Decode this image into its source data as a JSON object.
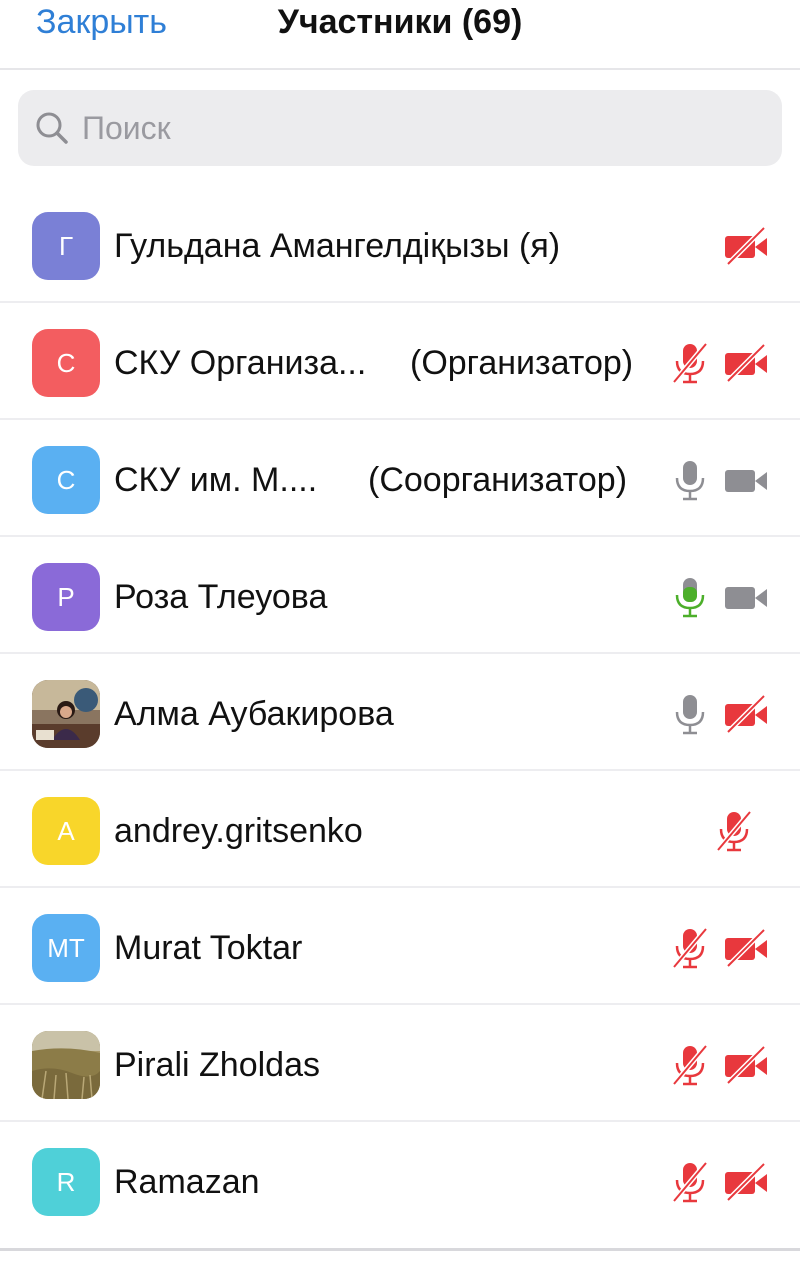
{
  "header": {
    "close_label": "Закрыть",
    "title": "Участники (69)"
  },
  "search": {
    "placeholder": "Поиск",
    "value": ""
  },
  "colors": {
    "accent": "#2f7fd6",
    "muted_red": "#e8383d",
    "active_green": "#4caf2a",
    "neutral_gray": "#8e8e93"
  },
  "participants": [
    {
      "initial": "Г",
      "name": "Гульдана Амангелдіқызы (я)",
      "role": "",
      "avatar_color": "#7a80d6",
      "mic": "none",
      "camera": "off"
    },
    {
      "initial": "С",
      "name": "СКУ Организа...",
      "role": "(Организатор)",
      "avatar_color": "#f35d60",
      "mic": "muted",
      "camera": "off"
    },
    {
      "initial": "С",
      "name": "СКУ им. М....",
      "role": "(Соорганизатор)",
      "avatar_color": "#5ab0f2",
      "mic": "on",
      "camera": "on"
    },
    {
      "initial": "Р",
      "name": "Роза Тлеуова",
      "role": "",
      "avatar_color": "#8a6ad8",
      "mic": "speaking",
      "camera": "on"
    },
    {
      "initial": "",
      "name": "Алма Аубакирова",
      "role": "",
      "avatar_color": "#6a5040",
      "mic": "on",
      "camera": "off"
    },
    {
      "initial": "A",
      "name": "andrey.gritsenko",
      "role": "",
      "avatar_color": "#f8d62a",
      "mic": "muted",
      "camera": "none"
    },
    {
      "initial": "MT",
      "name": "Murat Toktar",
      "role": "",
      "avatar_color": "#5ab0f2",
      "mic": "muted",
      "camera": "off"
    },
    {
      "initial": "",
      "name": "Pirali Zholdas",
      "role": "",
      "avatar_color": "#9a8a5a",
      "mic": "muted",
      "camera": "off"
    },
    {
      "initial": "R",
      "name": "Ramazan",
      "role": "",
      "avatar_color": "#4fd0d8",
      "mic": "muted",
      "camera": "off"
    }
  ]
}
